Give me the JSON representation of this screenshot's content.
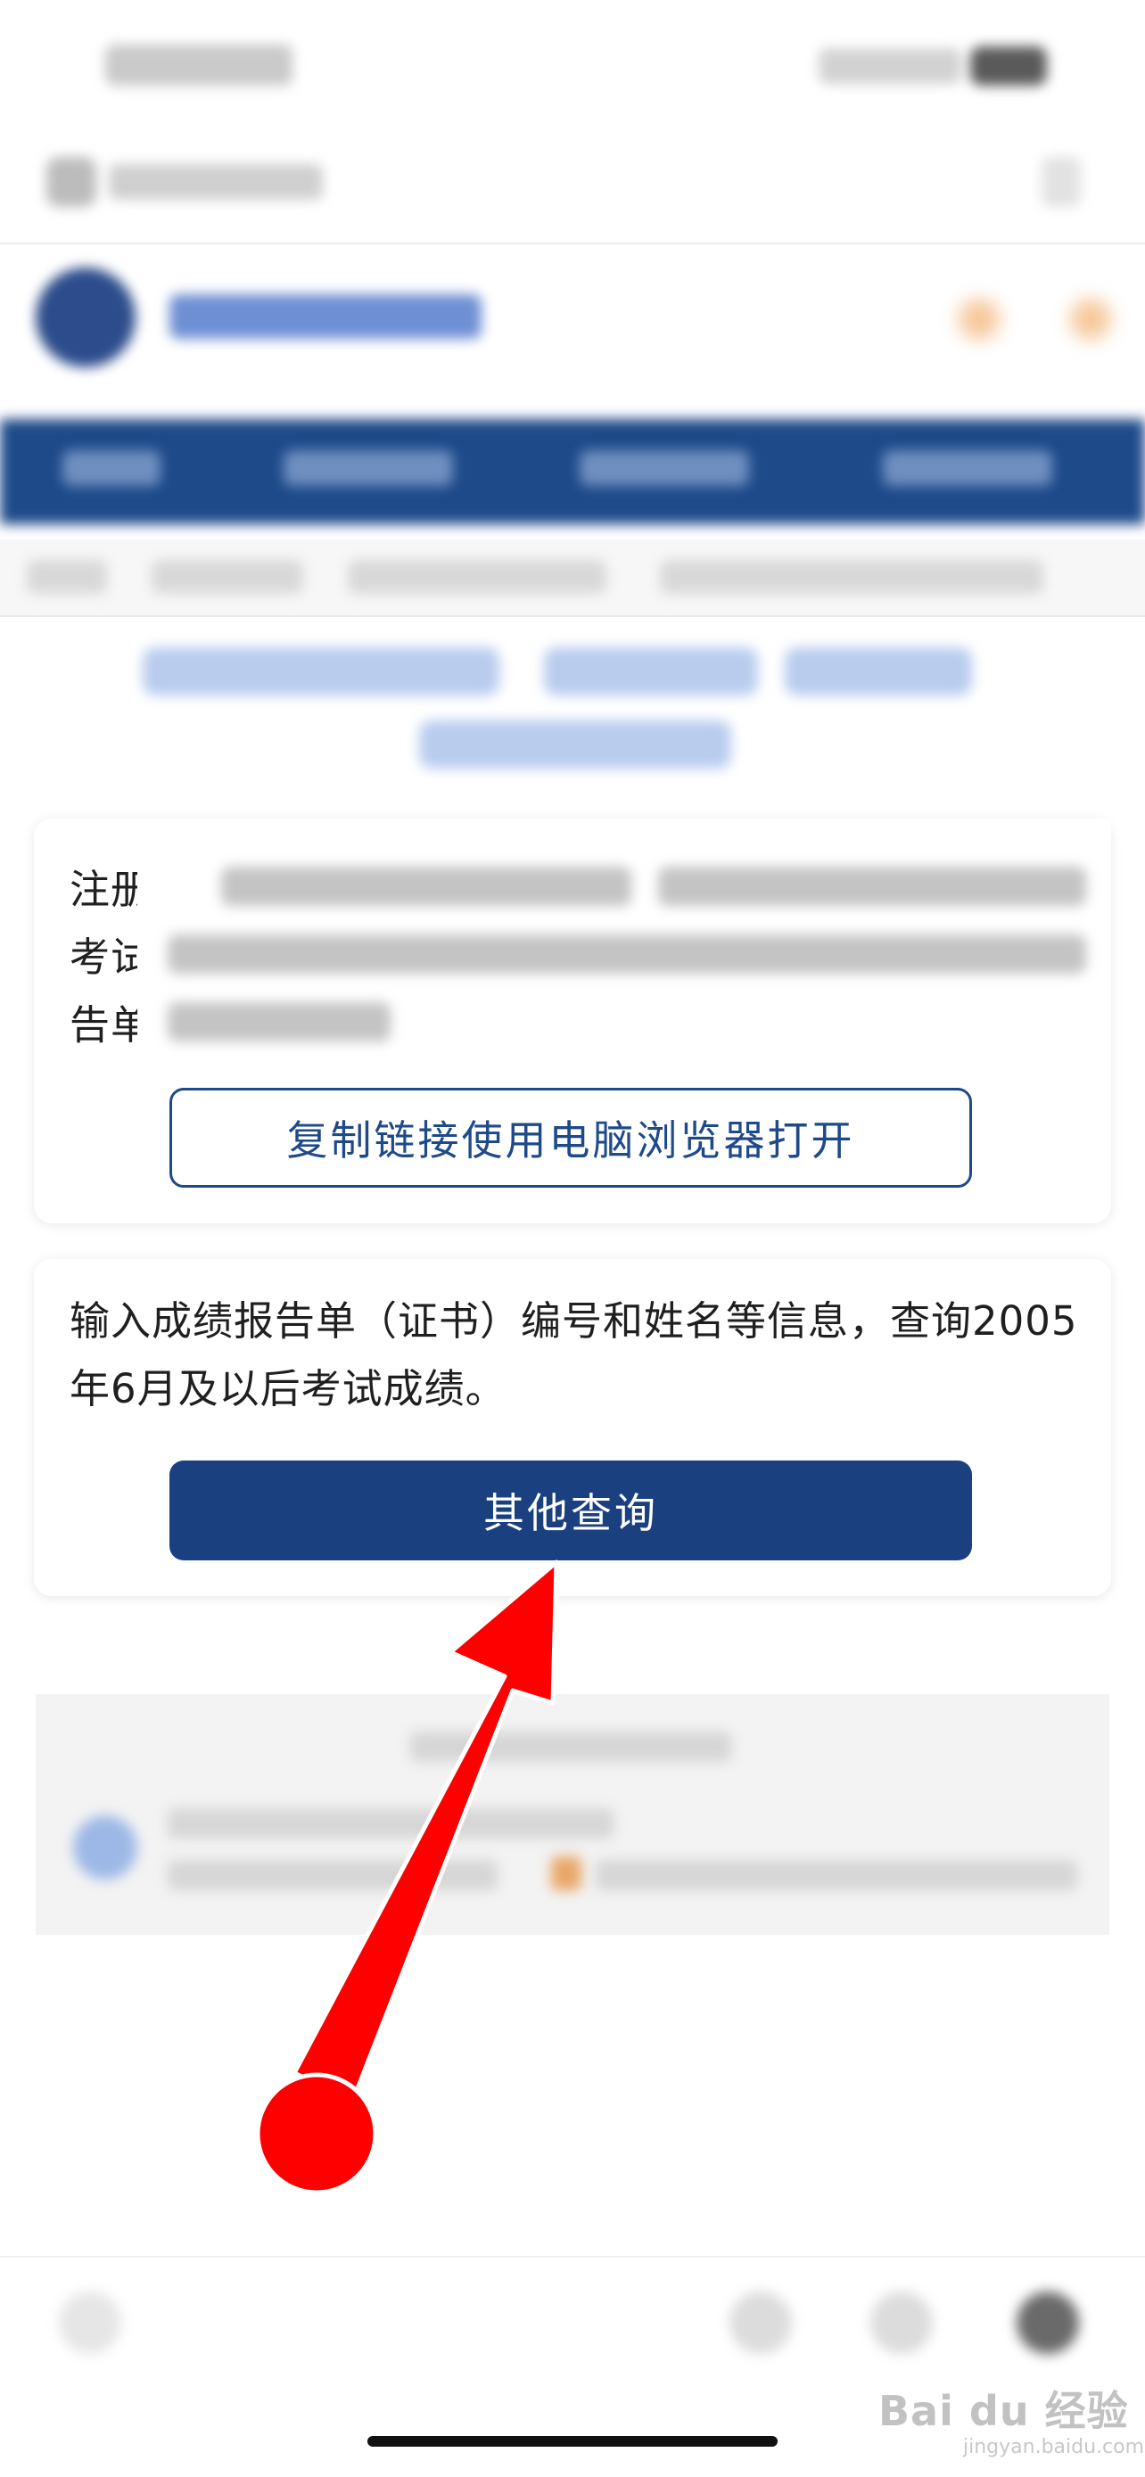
{
  "cards": {
    "register": {
      "text_fragments": [
        "注册",
        "考试",
        "告单"
      ],
      "copy_button_label": "复制链接使用电脑浏览器打开"
    },
    "other_query": {
      "description": "输入成绩报告单（证书）编号和姓名等信息，查询2005年6月及以后考试成绩。",
      "button_label": "其他查询"
    }
  },
  "watermark": {
    "brand": "Bai du 经验",
    "url": "jingyan.baidu.com"
  },
  "colors": {
    "brand_blue": "#1e4a8a",
    "button_blue": "#1a4080",
    "annotation_red": "#ff0000"
  },
  "icons": [
    "site-logo-icon",
    "back-icon",
    "share-icon",
    "tabs-icon",
    "menu-icon"
  ]
}
